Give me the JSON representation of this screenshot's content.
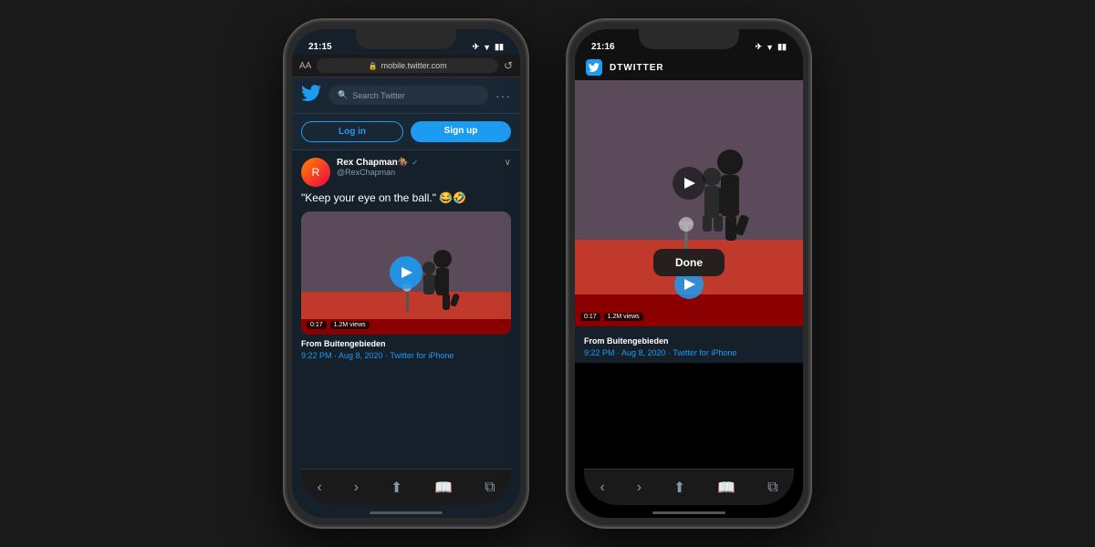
{
  "background": "#1a1a1a",
  "phone1": {
    "status": {
      "time": "21:15",
      "right_icons": "✈ ▶ 📶"
    },
    "browser": {
      "aa_label": "AA",
      "url": "mobile.twitter.com",
      "lock_icon": "🔒",
      "reload_icon": "↺"
    },
    "nav": {
      "search_placeholder": "Search Twitter",
      "more_label": "···"
    },
    "auth": {
      "login_label": "Log in",
      "signup_label": "Sign up"
    },
    "tweet": {
      "user_name": "Rex Chapman🏇",
      "user_handle": "@RexChapman",
      "verified": true,
      "text": "\"Keep your eye on the ball.\" 😂🤣",
      "video_duration": "0:17",
      "video_views": "1.2M views",
      "from_label": "From",
      "from_source": "Buitengebieden",
      "timestamp": "9:22 PM · Aug 8, 2020 · Twitter for iPhone"
    },
    "bottom_nav": [
      "‹",
      "›",
      "⬆",
      "📖",
      "⧉"
    ]
  },
  "phone2": {
    "status": {
      "time": "21:16",
      "right_icons": "✈ ▶ 📶"
    },
    "app_header": {
      "app_name": "DTWITTER"
    },
    "video": {
      "duration": "0:17",
      "views": "1.2M views",
      "done_label": "Done"
    },
    "tweet": {
      "from_label": "From",
      "from_source": "Buitengebieden",
      "timestamp": "9:22 PM · Aug 8, 2020 · Twitter for iPhone"
    },
    "bottom_nav": [
      "‹",
      "›",
      "⬆",
      "📖",
      "⧉"
    ]
  }
}
